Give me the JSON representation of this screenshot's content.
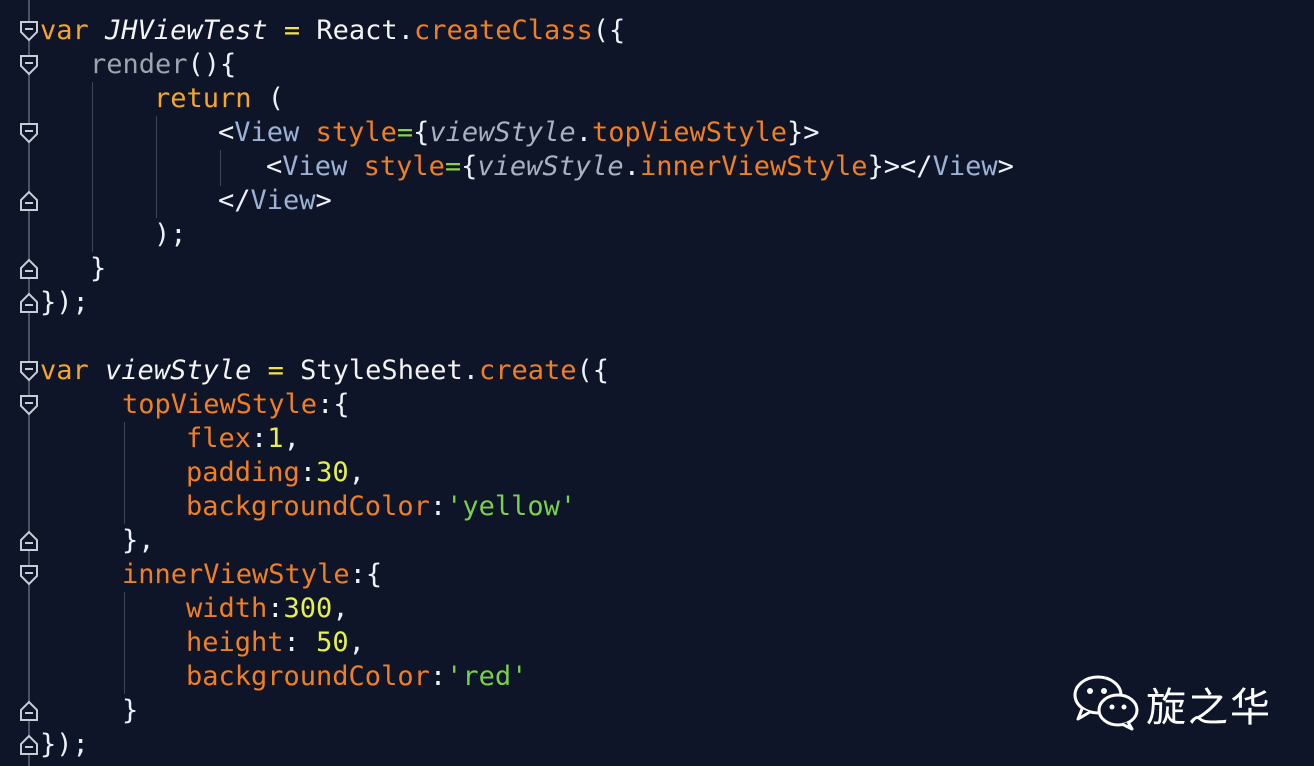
{
  "code": {
    "l1": [
      "var",
      " ",
      "JHViewTest",
      " ",
      "=",
      " ",
      "React",
      ".",
      "createClass",
      "({"
    ],
    "l2": [
      "render",
      "(){"
    ],
    "l3": [
      "return",
      " ("
    ],
    "l4": [
      "<",
      "View",
      " ",
      "style",
      "=",
      "{",
      "viewStyle",
      ".",
      "topViewStyle",
      "}>"
    ],
    "l5": [
      "<",
      "View",
      " ",
      "style",
      "=",
      "{",
      "viewStyle",
      ".",
      "innerViewStyle",
      "}></",
      "View",
      ">"
    ],
    "l6": [
      "</",
      "View",
      ">"
    ],
    "l7": [
      ");"
    ],
    "l8": [
      "}"
    ],
    "l9": [
      "});"
    ],
    "l10": [
      "var",
      " ",
      "viewStyle",
      " ",
      "=",
      " ",
      "StyleSheet",
      ".",
      "create",
      "({"
    ],
    "l11": [
      "topViewStyle",
      ":{"
    ],
    "l12": [
      "flex",
      ":",
      "1",
      ","
    ],
    "l13": [
      "padding",
      ":",
      "30",
      ","
    ],
    "l14": [
      "backgroundColor",
      ":",
      "'yellow'"
    ],
    "l15": [
      "},"
    ],
    "l16": [
      "innerViewStyle",
      ":{"
    ],
    "l17": [
      "width",
      ":",
      "300",
      ","
    ],
    "l18": [
      "height",
      ": ",
      "50",
      ","
    ],
    "l19": [
      "backgroundColor",
      ":",
      "'red'"
    ],
    "l20": [
      "}"
    ],
    "l21": [
      "});"
    ]
  },
  "watermark": {
    "label": "旋之华",
    "icon": "wechat-icon"
  },
  "colors": {
    "background": "#0e1529",
    "keyword": "#f6a623",
    "method": "#f07f21",
    "number": "#e5f04a",
    "string": "#78d14b",
    "tag": "#9db1d4"
  }
}
